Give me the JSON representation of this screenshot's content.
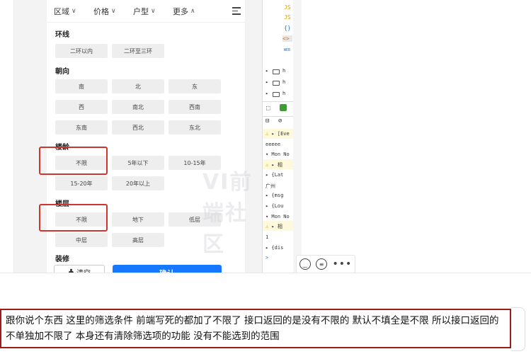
{
  "filter": {
    "tabs": [
      {
        "label": "区域",
        "chev": "∨"
      },
      {
        "label": "价格",
        "chev": "∨"
      },
      {
        "label": "户型",
        "chev": "∨"
      },
      {
        "label": "更多",
        "chev": "∧"
      }
    ],
    "sections": {
      "ring": {
        "title": "环线",
        "options": [
          "二环以内",
          "二环至三环"
        ]
      },
      "orientation": {
        "title": "朝向",
        "options": [
          "南",
          "北",
          "东",
          "西",
          "南北",
          "西南",
          "东南",
          "西北",
          "东北"
        ]
      },
      "age": {
        "title": "楼龄",
        "options": [
          "不限",
          "5年以下",
          "10-15年",
          "15-20年",
          "20年以上"
        ]
      },
      "floor": {
        "title": "楼层",
        "options": [
          "不限",
          "地下",
          "低层",
          "中层",
          "高层"
        ]
      },
      "decoration": {
        "title": "装修"
      }
    },
    "reset_label": "清空",
    "confirm_label": "确认"
  },
  "watermark": "VI前端社区",
  "devtools": {
    "files": [
      "JS",
      "JS",
      "{}",
      "<>",
      "WEB"
    ],
    "folders": [
      "h",
      "h",
      "h"
    ],
    "console": [
      "▸ [Eve",
      "eeeee",
      "▾ Mon No",
      "▸ 相",
      "▸ {Lat",
      "广州",
      "▸ {msg",
      "▸ {Lou",
      "▾ Mon No",
      "▸ 相",
      "1",
      "▸ {dis",
      ">"
    ]
  },
  "message": "跟你说个东西   这里的筛选条件   前端写死的都加了不限了   接口返回的是没有不限的      默认不填全是不限   所以接口返回的不单独加不限了   本身还有清除筛选项的功能   没有不能选到的范围",
  "colors": {
    "highlight": "#d0342c",
    "confirm": "#1677ff",
    "message_border": "#9b1c1c"
  }
}
